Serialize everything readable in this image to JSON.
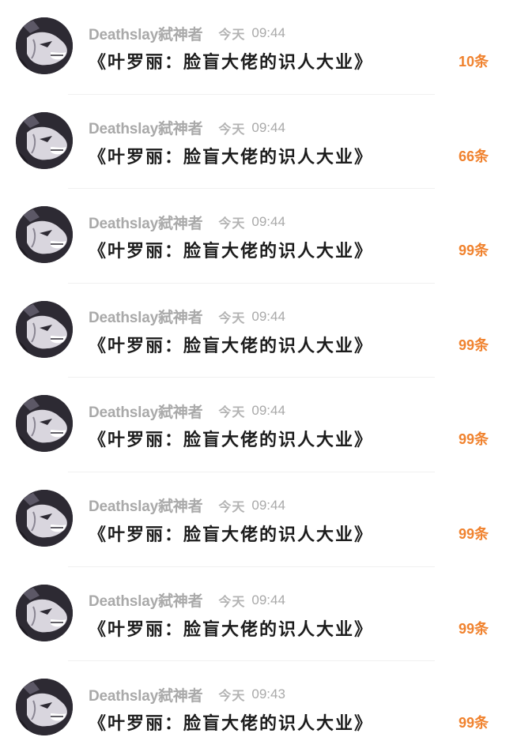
{
  "messages": [
    {
      "username": "Deathslay弑神者",
      "day": "今天",
      "time": "09:44",
      "title": "《叶罗丽：脸盲大佬的识人大业》",
      "count": "10条"
    },
    {
      "username": "Deathslay弑神者",
      "day": "今天",
      "time": "09:44",
      "title": "《叶罗丽：脸盲大佬的识人大业》",
      "count": "66条"
    },
    {
      "username": "Deathslay弑神者",
      "day": "今天",
      "time": "09:44",
      "title": "《叶罗丽：脸盲大佬的识人大业》",
      "count": "99条"
    },
    {
      "username": "Deathslay弑神者",
      "day": "今天",
      "time": "09:44",
      "title": "《叶罗丽：脸盲大佬的识人大业》",
      "count": "99条"
    },
    {
      "username": "Deathslay弑神者",
      "day": "今天",
      "time": "09:44",
      "title": "《叶罗丽：脸盲大佬的识人大业》",
      "count": "99条"
    },
    {
      "username": "Deathslay弑神者",
      "day": "今天",
      "time": "09:44",
      "title": "《叶罗丽：脸盲大佬的识人大业》",
      "count": "99条"
    },
    {
      "username": "Deathslay弑神者",
      "day": "今天",
      "time": "09:44",
      "title": "《叶罗丽：脸盲大佬的识人大业》",
      "count": "99条"
    },
    {
      "username": "Deathslay弑神者",
      "day": "今天",
      "time": "09:43",
      "title": "《叶罗丽：脸盲大佬的识人大业》",
      "count": "99条"
    }
  ],
  "avatar_icon": "wolf-avatar-icon",
  "colors": {
    "count": "#f0822e",
    "meta": "#a9a9a9",
    "title": "#1c1c1c",
    "background": "#ffffff"
  }
}
